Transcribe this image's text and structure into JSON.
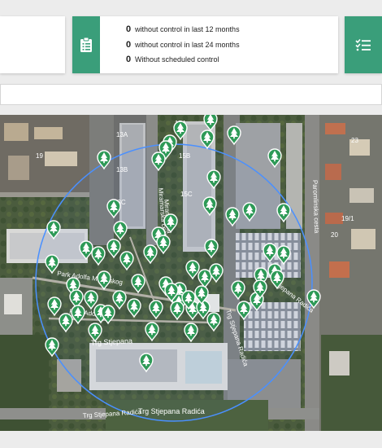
{
  "stats": {
    "rows": [
      {
        "count": "0",
        "label": "without control in last 12 months"
      },
      {
        "count": "0",
        "label": "without control in last 24 months"
      },
      {
        "count": "0",
        "label": "Without scheduled control"
      }
    ]
  },
  "icons": {
    "stats_card": "clipboard-icon",
    "right_card": "checklist-icon",
    "map_marker": "tree-marker-icon"
  },
  "colors": {
    "accent": "#3a9e7a",
    "marker": "#2e9a57",
    "circle": "#4a90ff"
  },
  "map": {
    "labels": {
      "street_miramarska": "Miramarska cesta",
      "street_miramarska_2": "Miramarska",
      "street_paromlinska": "Paromlinska cesta",
      "park": "Park Adolfa Mošinskog",
      "park_2": "Park Adolfa",
      "trg_radica_1": "Trg Stjepana Radića",
      "trg_radica_2": "Trg Stjepana Radića",
      "trg_stjepana": "Trg Stjepana",
      "trg_radica_3": "Trg Stjepana Radića",
      "trg_radica_4": "Stjepana Radića",
      "bld_15a": "15A",
      "bld_15b": "15B",
      "bld_15c": "15C",
      "bld_13a": "13A",
      "bld_13b": "13B",
      "bld_13c": "13C",
      "bld_19": "19",
      "bld_19_1": "19/1",
      "bld_20": "20",
      "bld_23": "23"
    },
    "marker_count": "68"
  }
}
